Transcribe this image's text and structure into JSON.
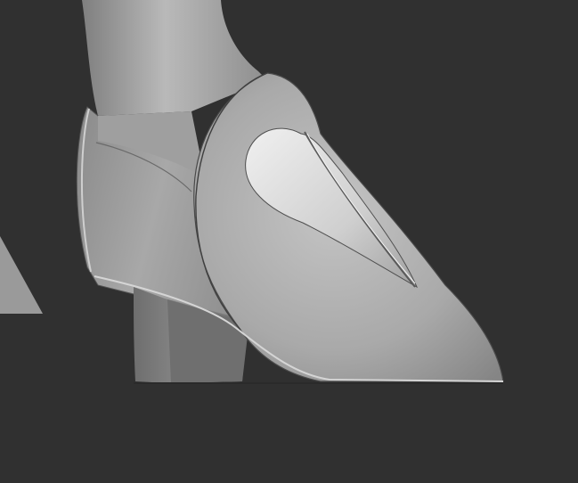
{
  "viewport": {
    "background": "#303030",
    "model": "shoe-sculpt",
    "material": "matcap-gray"
  },
  "colors": {
    "background": "#303030",
    "shaft": "#a7a7a7",
    "heel_counter": "#9b9b9b",
    "vamp": "#b2b2b2",
    "heart_inlay": "#dcdcdc",
    "heel": "#7d7d7d",
    "outline": "#505050"
  }
}
